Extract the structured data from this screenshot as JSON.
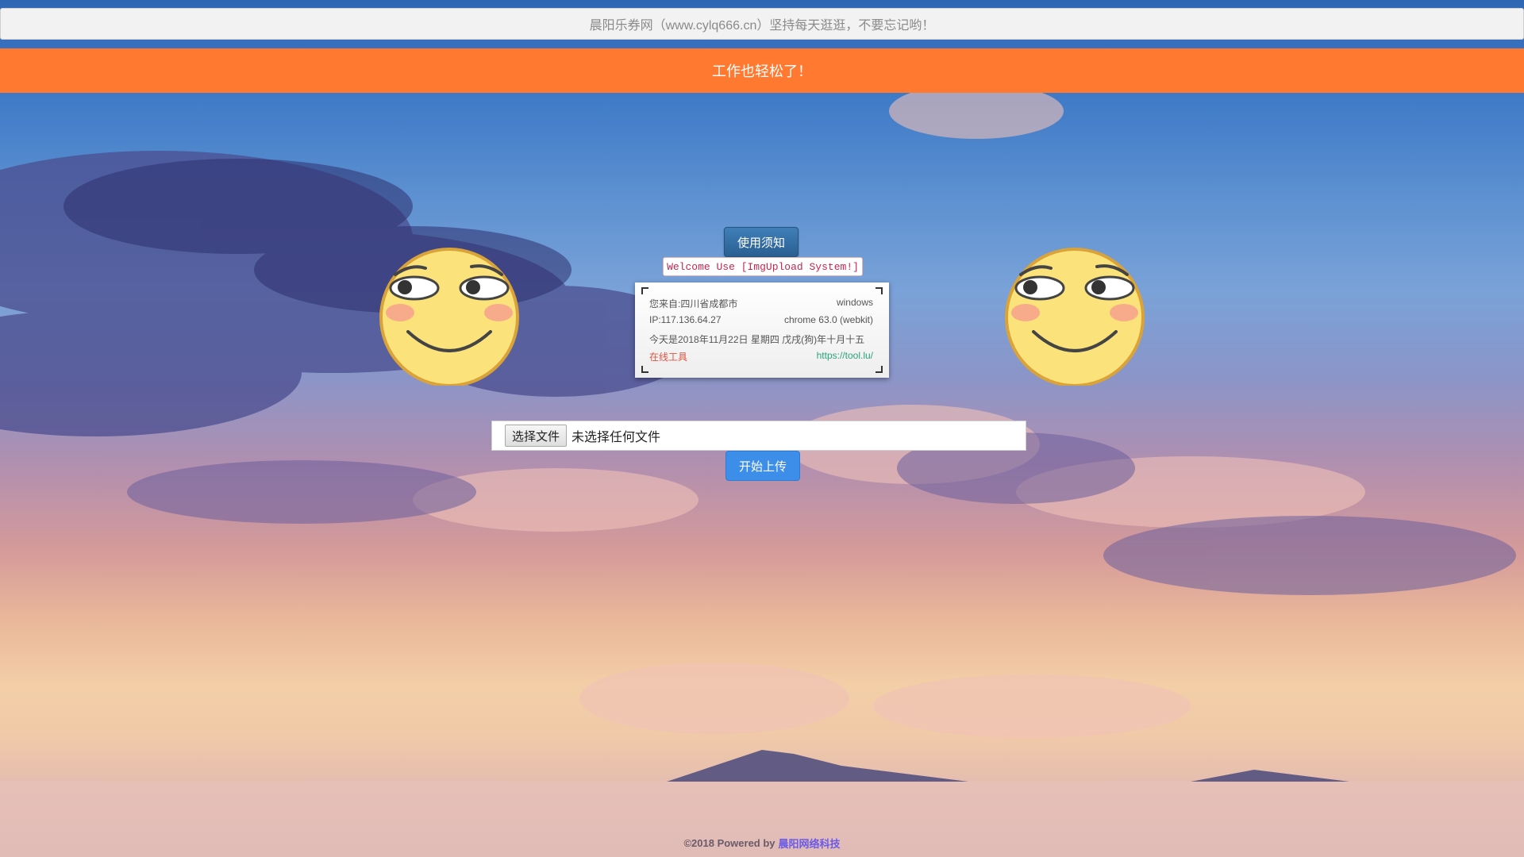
{
  "notice_bar": {
    "text": "晨阳乐券网（www.cylq666.cn）坚持每天逛逛，不要忘记哟！"
  },
  "banner": {
    "text": "工作也轻松了！"
  },
  "usage_button": {
    "label": "使用须知"
  },
  "welcome": {
    "text": "Welcome Use [ImgUpload System!]"
  },
  "info_card": {
    "location": "您来自:四川省成都市",
    "os": "windows",
    "ip": "IP:117.136.64.27",
    "browser": "chrome 63.0 (webkit)",
    "date": "今天是2018年11月22日 星期四 戊戌(狗)年十月十五",
    "tool_name": "在线工具",
    "tool_url": "https://tool.lu/"
  },
  "upload": {
    "choose_label": "选择文件",
    "no_file_text": "未选择任何文件",
    "start_label": "开始上传"
  },
  "footer": {
    "text": "©2018 Powered by",
    "link_text": "晨阳网络科技"
  },
  "colors": {
    "banner": "#ff7a30",
    "usage_button": "#2f6aa0",
    "upload_button": "#3d8ee8",
    "emoji_face": "#fbe27a"
  },
  "icons": [
    "smirk-emoji-icon"
  ]
}
